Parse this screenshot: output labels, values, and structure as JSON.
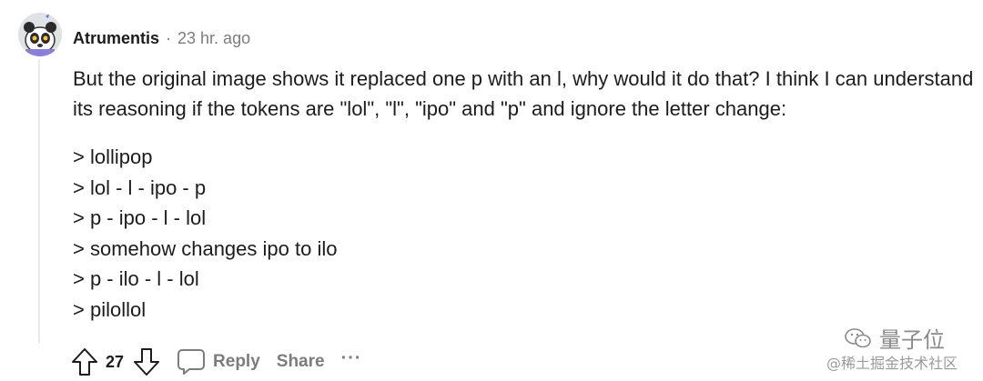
{
  "comment": {
    "author": "Atrumentis",
    "separator": "·",
    "time": "23 hr. ago",
    "paragraph": "But the original image shows it replaced one p with an l, why would it do that? I think I can understand its reasoning if the tokens are \"lol\", \"l\", \"ipo\" and \"p\" and ignore the letter change:",
    "quotes": [
      "> lollipop",
      "> lol - l - ipo - p",
      "> p - ipo - l - lol",
      "> somehow changes ipo to ilo",
      "> p - ilo - l - lol",
      "> pilollol"
    ]
  },
  "actions": {
    "upvote_icon": "arrow-up-icon",
    "score": "27",
    "downvote_icon": "arrow-down-icon",
    "reply_icon": "speech-bubble-icon",
    "reply_label": "Reply",
    "share_label": "Share",
    "more_label": "···"
  },
  "watermark": {
    "logo_text": "量子位",
    "sub_text": "@稀土掘金技术社区"
  },
  "colors": {
    "text": "#1c1c1c",
    "muted": "#7c7c7c",
    "thread_line": "#e8eaec"
  }
}
